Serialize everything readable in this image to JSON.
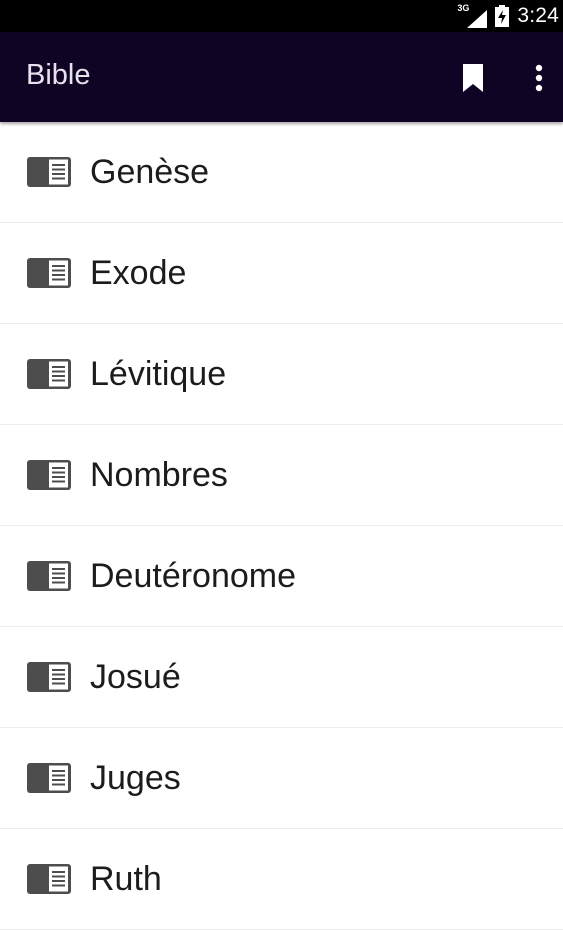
{
  "status_bar": {
    "network_type": "3G",
    "time": "3:24",
    "icons": [
      "signal-icon",
      "battery-charging-icon"
    ]
  },
  "app_bar": {
    "title": "Bible",
    "actions": [
      "bookmark-icon",
      "overflow-menu-icon"
    ],
    "background_color": "#0f0424"
  },
  "books": [
    {
      "label": "Genèse"
    },
    {
      "label": "Exode"
    },
    {
      "label": "Lévitique"
    },
    {
      "label": "Nombres"
    },
    {
      "label": "Deutéronome"
    },
    {
      "label": "Josué"
    },
    {
      "label": "Juges"
    },
    {
      "label": "Ruth"
    }
  ],
  "list_icon": "book-icon"
}
